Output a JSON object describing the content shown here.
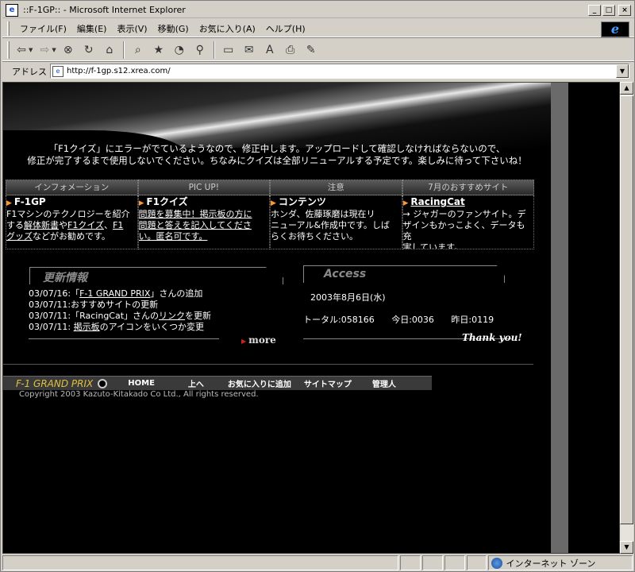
{
  "window": {
    "title": "::F-1GP:: - Microsoft Internet Explorer",
    "minimize": "_",
    "maximize": "□",
    "close": "×"
  },
  "menu": {
    "items": [
      "ファイル(F)",
      "編集(E)",
      "表示(V)",
      "移動(G)",
      "お気に入り(A)",
      "ヘルプ(H)"
    ]
  },
  "toolbar": {
    "icons": [
      "back-arrow-icon",
      "forward-arrow-icon",
      "stop-icon",
      "refresh-icon",
      "home-icon",
      "search-icon",
      "favorites-icon",
      "history-icon",
      "channels-icon",
      "fullscreen-icon",
      "mail-icon",
      "font-icon",
      "print-icon",
      "edit-icon"
    ]
  },
  "address": {
    "label": "アドレス",
    "url": "http://f-1gp.s12.xrea.com/"
  },
  "page": {
    "notice_line1": "「F1クイズ」にエラーがでているようなので、修正中します。アップロードして確認しなければならないので、",
    "notice_line2": "修正が完了するまで使用しないでください。ちなみにクイズは全部リニューアルする予定です。楽しみに待って下さいね！",
    "info_headers": [
      "インフォメーション",
      "PIC UP!",
      "注意",
      "7月のおすすめサイト"
    ],
    "info": {
      "col1": {
        "title": "F-1GP",
        "text_a": "F1マシンのテクノロジーを紹介",
        "text_b": "する",
        "link1": "解体新書",
        "text_c": "や",
        "link2": "F1クイズ",
        "text_d": "、",
        "link3a": "F1",
        "link3b": "グッズ",
        "text_e": "などがお勧めです。"
      },
      "col2": {
        "title": "F1クイズ",
        "line1": "問題を募集中！掲示板の方に",
        "line2": "問題と答えを記入してくださ",
        "line3": "い。匿名可です。"
      },
      "col3": {
        "title": "コンテンツ",
        "line1": "ホンダ、佐藤琢磨は現在リ",
        "line2": "ニューアル&作成中です。しば",
        "line3": "らくお待ちください。"
      },
      "col4": {
        "title": "RacingCat",
        "line1": "→ ジャガーのファンサイト。デ",
        "line2": "ザインもかっこよく、データも充",
        "line3": "実しています。"
      }
    },
    "updates": {
      "title": "更新情報",
      "item1_a": "03/07/16:「",
      "item1_link": "F-1 GRAND PRIX",
      "item1_b": "」さんの追加",
      "item2": "03/07/11:おすすめサイトの更新",
      "item3_a": "03/07/11:「RacingCat」さんの",
      "item3_link": "リンク",
      "item3_b": "を更新",
      "item4_a": "03/07/11: ",
      "item4_link": "掲示板",
      "item4_b": "のアイコンをいくつか変更",
      "more": "more"
    },
    "access": {
      "title": "Access",
      "date": "2003年8月6日(水)",
      "total": "トータル:058166",
      "today": "今日:0036",
      "yesterday": "昨日:0119",
      "thanks": "Thank you!"
    },
    "footer": {
      "brand": "F-1 GRAND PRIX",
      "nav": [
        "HOME",
        "上へ",
        "お気に入りに追加",
        "サイトマップ",
        "管理人"
      ],
      "copyright": "Copyright 2003 Kazuto-Kitakado Co Ltd., All rights reserved."
    }
  },
  "status": {
    "zone": "インターネット ゾーン"
  }
}
